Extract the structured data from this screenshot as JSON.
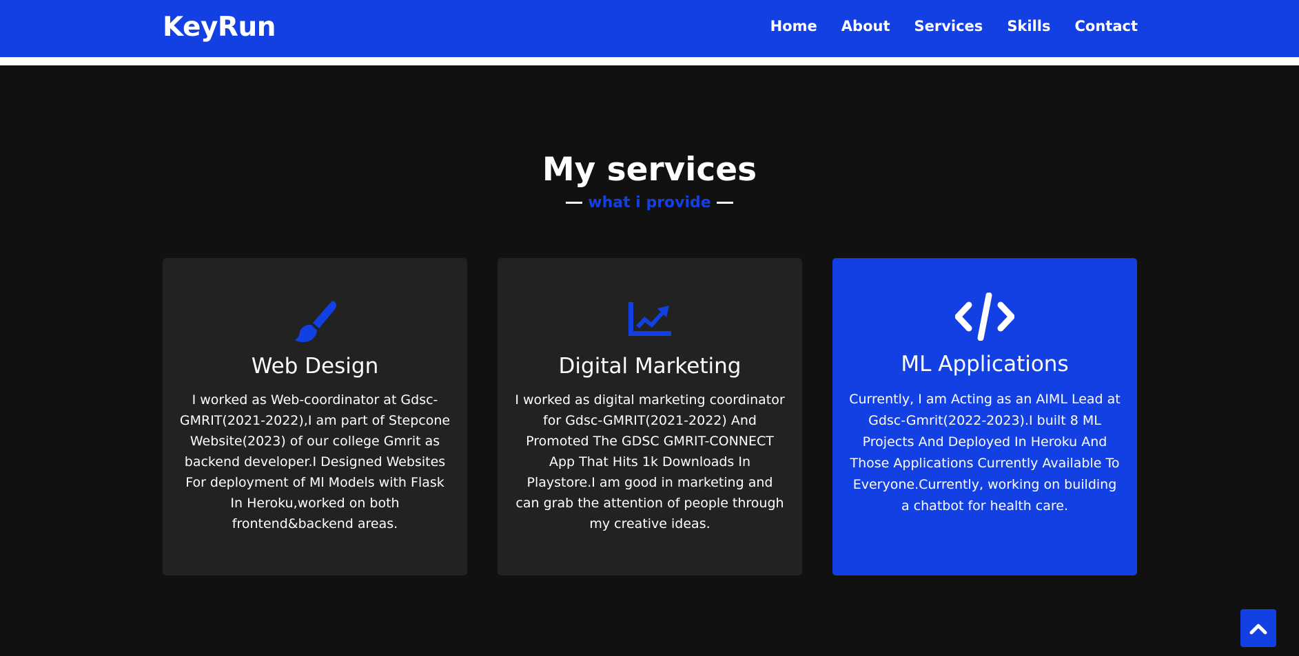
{
  "brand": {
    "logo_text": "KeyRun",
    "accent_color": "#1340e2"
  },
  "nav": {
    "items": [
      {
        "label": "Home"
      },
      {
        "label": "About"
      },
      {
        "label": "Services"
      },
      {
        "label": "Skills"
      },
      {
        "label": "Contact"
      }
    ]
  },
  "services": {
    "title": "My services",
    "subtitle": "what i provide",
    "cards": [
      {
        "icon": "paintbrush-icon",
        "title": "Web Design",
        "text": "I worked as Web-coordinator at Gdsc-GMRIT(2021-2022),I am part of Stepcone Website(2023) of our college Gmrit as backend developer.I Designed Websites For deployment of Ml Models with Flask In Heroku,worked on both frontend&backend areas."
      },
      {
        "icon": "chart-line-icon",
        "title": "Digital Marketing",
        "text": "I worked as digital marketing coordinator for Gdsc-GMRIT(2021-2022) And Promoted The GDSC GMRIT-CONNECT App That Hits 1k Downloads In Playstore.I am good in marketing and can grab the attention of people through my creative ideas."
      },
      {
        "icon": "code-icon",
        "title": "ML Applications",
        "text": "Currently, I am Acting as an AIML Lead at Gdsc-Gmrit(2022-2023).I built 8 ML Projects And Deployed In Heroku And Those Applications Currently Available To Everyone.Currently, working on building a chatbot for health care."
      }
    ]
  },
  "scroll_top": {
    "icon": "chevron-up-icon"
  }
}
